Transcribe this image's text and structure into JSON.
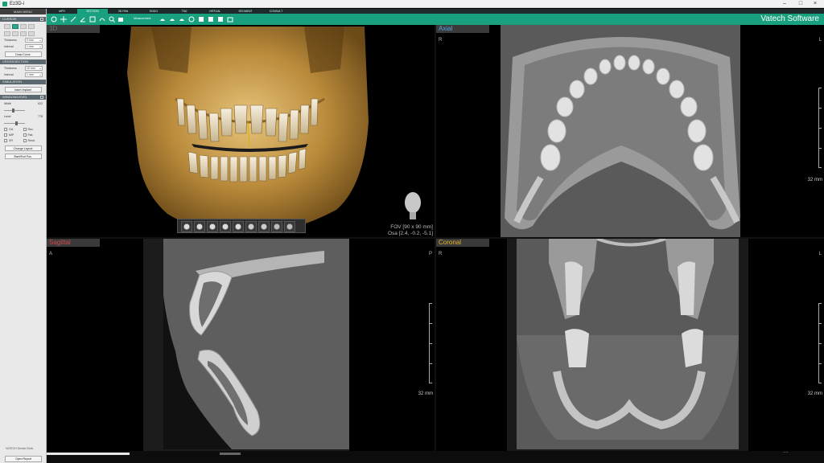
{
  "window": {
    "title": "Ez3D-i",
    "minimize": "–",
    "maximize": "□",
    "close": "×"
  },
  "sidebar": {
    "header": "MAIN MENU",
    "sections": {
      "cursor": "CURSOR",
      "crosssection": "CROSSSECTION",
      "simulation": "SIMULATION",
      "windowing": "WINDOW/LEVEL"
    },
    "thickness_label": "Thickness",
    "thickness_value": "0 mm",
    "interval_label": "Interval",
    "interval_value": "1 mm",
    "draw_curve": "Draw Curve",
    "thickness2_label": "Thickness",
    "thickness2_value": "10 mm",
    "interval2_label": "Interval",
    "interval2_value": "1 mm",
    "insert_implant": "Insert Implant",
    "width_label": "Width",
    "width_value": "622",
    "level_label": "Level",
    "level_value": "778",
    "checks": [
      "Ort.",
      "Rec.",
      "MIP",
      "Flat.",
      "XR",
      "Rend."
    ],
    "change_layout": "Change Layout",
    "start_end_pos": "Start/End Pos.",
    "vendor": "VATECH Dental Clinic",
    "open_report": "Open Report"
  },
  "tabs": [
    "MPR",
    "SECTION",
    "3D PAN",
    "ENDO",
    "TMJ",
    "VIRTUAL",
    "SEGMENT",
    "CONSULT"
  ],
  "active_tab_index": 1,
  "toolbar": {
    "brand": "Vatech Software",
    "measurement_label": "Measurement"
  },
  "views": {
    "v3d": {
      "title": "3D",
      "fov": "FOV [90 x 90 mm]",
      "osa": "Osa [2.4, -0.2, -5.1]"
    },
    "axial": {
      "title": "Axial",
      "left": "R",
      "right": "L",
      "scale": "32 mm"
    },
    "sagittal": {
      "title": "Sagittal",
      "left": "A",
      "right": "P",
      "scale": "32 mm"
    },
    "coronal": {
      "title": "Coronal",
      "left": "R",
      "right": "L",
      "scale": "32 mm"
    }
  },
  "status": {
    "right_text": "⠒⠒"
  },
  "colors": {
    "accent": "#19a07f",
    "axial_title": "#5aa3e0",
    "sagittal_title": "#d04a4a",
    "coronal_title": "#e0b52a"
  }
}
